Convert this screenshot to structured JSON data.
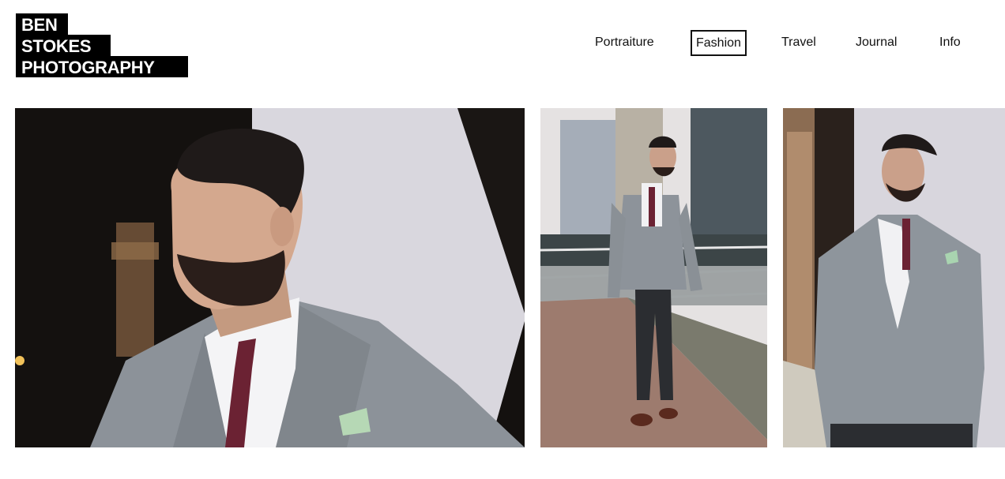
{
  "logo": {
    "line1": "BEN",
    "line2": "STOKES",
    "line3": "PHOTOGRAPHY"
  },
  "nav": {
    "items": [
      {
        "label": "Portraiture",
        "active": false
      },
      {
        "label": "Fashion",
        "active": true
      },
      {
        "label": "Travel",
        "active": false
      },
      {
        "label": "Journal",
        "active": false
      },
      {
        "label": "Info",
        "active": false
      }
    ]
  },
  "gallery": {
    "photos": [
      {
        "subject": "fashion-portrait-closeup"
      },
      {
        "subject": "fashion-full-length-walking"
      },
      {
        "subject": "fashion-three-quarter-standing"
      }
    ]
  },
  "colors": {
    "accent": "#000000",
    "background": "#ffffff",
    "suit": "#8a9096",
    "tie": "#6b2233"
  }
}
